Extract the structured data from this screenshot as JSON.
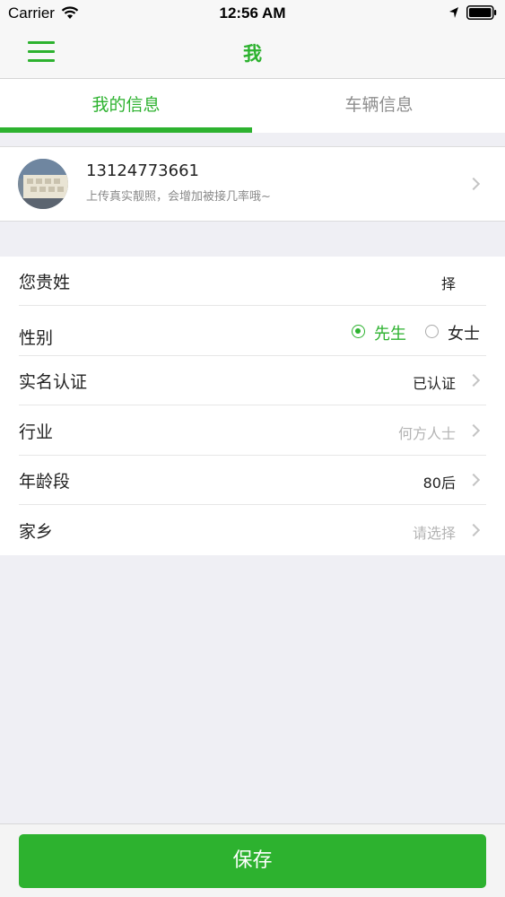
{
  "status_bar": {
    "carrier": "Carrier",
    "time": "12:56 AM"
  },
  "nav": {
    "title": "我",
    "menu_icon": "hamburger-menu-icon"
  },
  "tabs": [
    {
      "label": "我的信息",
      "active": true
    },
    {
      "label": "车辆信息",
      "active": false
    }
  ],
  "profile": {
    "phone": "13124773661",
    "hint": "上传真实靓照，会增加被接几率哦~"
  },
  "form": {
    "surname": {
      "label": "您贵姓",
      "value": "择"
    },
    "gender": {
      "label": "性别",
      "options": [
        "先生",
        "女士"
      ],
      "selected": "先生"
    },
    "verification": {
      "label": "实名认证",
      "value": "已认证"
    },
    "industry": {
      "label": "行业",
      "placeholder": "何方人士"
    },
    "age_group": {
      "label": "年龄段",
      "value": "80后"
    },
    "hometown": {
      "label": "家乡",
      "placeholder": "请选择"
    }
  },
  "save_label": "保存",
  "colors": {
    "accent": "#2db22f",
    "background": "#efeff4"
  }
}
